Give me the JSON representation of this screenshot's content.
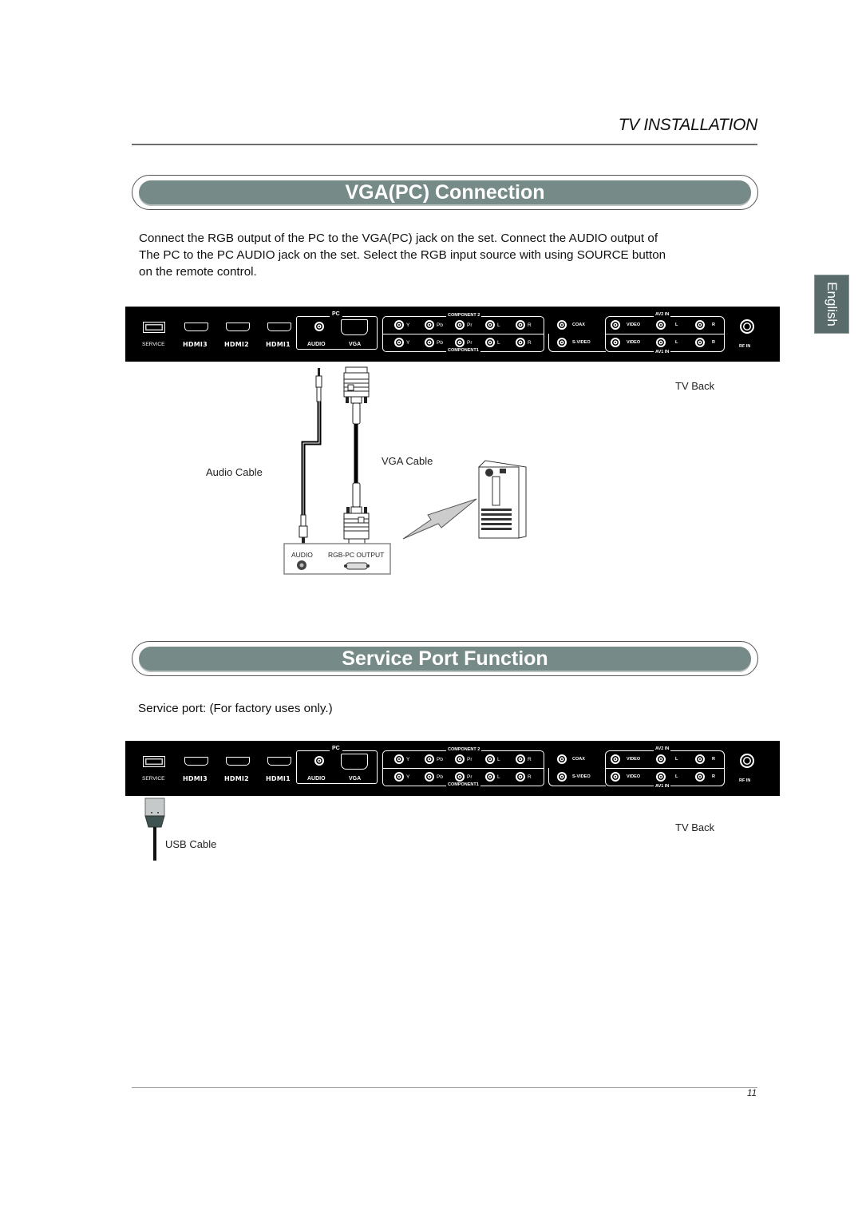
{
  "header": {
    "section_title": "TV INSTALLATION"
  },
  "language_tab": "English",
  "sections": [
    {
      "title": "VGA(PC)  Connection",
      "body": [
        "Connect the RGB output of the PC to the  VGA(PC)   jack on the set. Connect the AUDIO output of",
        "The PC to the PC AUDIO jack on the set. Select the RGB input source with using SOURCE button",
        "on the remote control."
      ],
      "diagram": {
        "tv_back_label": "TV Back",
        "audio_cable_label": "Audio Cable",
        "vga_cable_label": "VGA Cable",
        "pc_panel": {
          "audio_label": "AUDIO",
          "rgb_output_label": "RGB-PC OUTPUT"
        }
      }
    },
    {
      "title": "Service Port Function",
      "body": [
        "Service port:  (For factory uses only.)"
      ],
      "diagram": {
        "tv_back_label": "TV Back",
        "usb_cable_label": "USB  Cable"
      }
    }
  ],
  "tv_panel": {
    "service": "SERVICE",
    "hdmi": [
      "HDMI3",
      "HDMI2",
      "HDMI1"
    ],
    "pc_group": "PC",
    "pc_audio": "AUDIO",
    "pc_vga": "VGA",
    "component2": "COMPONENT 2",
    "component1": "COMPONENT1",
    "component_jacks": [
      "Y",
      "Pb",
      "Pr",
      "L",
      "R"
    ],
    "coax": "COAX",
    "svideo": "S-VIDEO",
    "video": "VIDEO",
    "av2": "AV2 IN",
    "av1": "AV1 IN",
    "av_jacks": [
      "L",
      "R"
    ],
    "rf": "RF IN"
  },
  "footer": {
    "page_number": "11"
  },
  "colors": {
    "banner": "#768a87",
    "panel": "#000000",
    "lang_tab": "#5a6b6b"
  }
}
